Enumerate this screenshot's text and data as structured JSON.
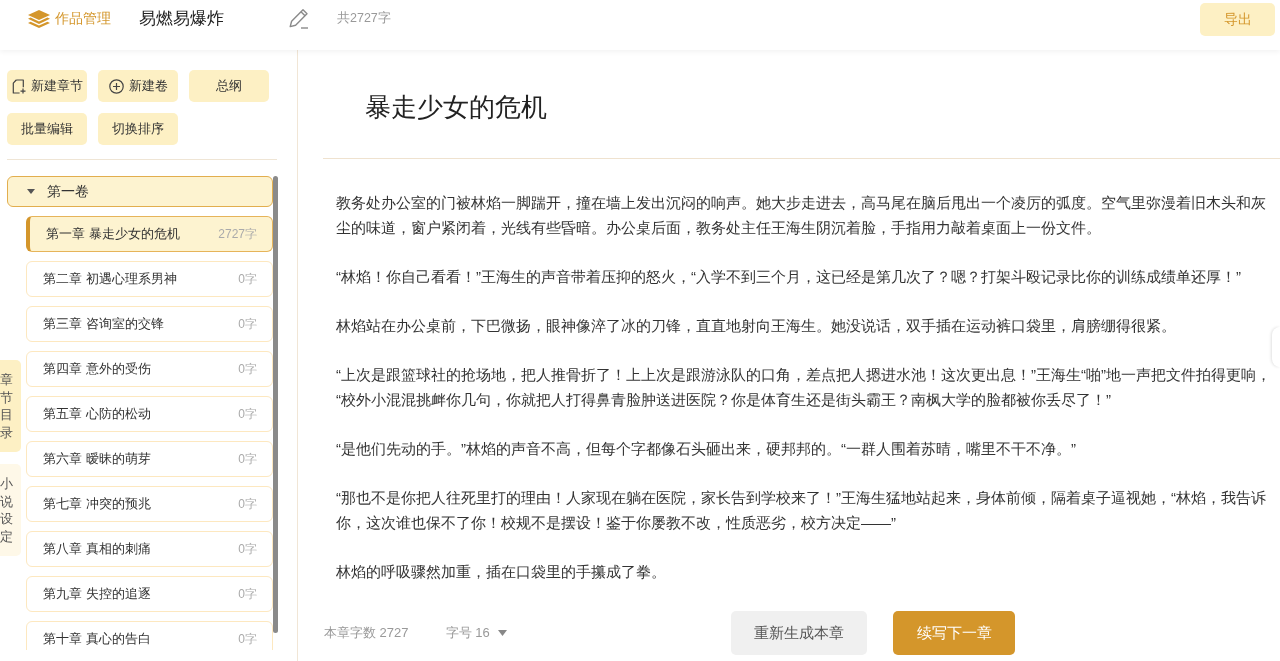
{
  "header": {
    "section_link": "作品管理",
    "book_title": "易燃易爆炸",
    "total_words": "共2727字",
    "export_button": "导出"
  },
  "toolbar": [
    {
      "label": "新建章节",
      "kind": "page"
    },
    {
      "label": "新建卷",
      "kind": "circle"
    },
    {
      "label": "总纲",
      "kind": "plain"
    },
    {
      "label": "批量编辑",
      "kind": "plain"
    },
    {
      "label": "切换排序",
      "kind": "plain"
    }
  ],
  "side_tabs": [
    {
      "label": "章节目录",
      "selected": true
    },
    {
      "label": "小说设定",
      "selected": false
    }
  ],
  "volumes": [
    {
      "title": "第一卷",
      "expanded": true,
      "children": [
        {
          "title": "第一章 暴走少女的危机",
          "words": "2727字",
          "selected": true
        },
        {
          "title": "第二章 初遇心理系男神",
          "words": "0字",
          "selected": false
        },
        {
          "title": "第三章 咨询室的交锋",
          "words": "0字",
          "selected": false
        },
        {
          "title": "第四章 意外的受伤",
          "words": "0字",
          "selected": false
        },
        {
          "title": "第五章 心防的松动",
          "words": "0字",
          "selected": false
        },
        {
          "title": "第六章 暧昧的萌芽",
          "words": "0字",
          "selected": false
        },
        {
          "title": "第七章 冲突的预兆",
          "words": "0字",
          "selected": false
        },
        {
          "title": "第八章 真相的刺痛",
          "words": "0字",
          "selected": false
        },
        {
          "title": "第九章 失控的追逐",
          "words": "0字",
          "selected": false
        },
        {
          "title": "第十章 真心的告白",
          "words": "0字",
          "selected": false
        }
      ]
    }
  ],
  "editor": {
    "title": "暴走少女的危机",
    "paragraphs": [
      "教务处办公室的门被林焰一脚踹开，撞在墙上发出沉闷的响声。她大步走进去，高马尾在脑后甩出一个凌厉的弧度。空气里弥漫着旧木头和灰尘的味道，窗户紧闭着，光线有些昏暗。办公桌后面，教务处主任王海生阴沉着脸，手指用力敲着桌面上一份文件。",
      "“林焰！你自己看看！”王海生的声音带着压抑的怒火，“入学不到三个月，这已经是第几次了？嗯？打架斗殴记录比你的训练成绩单还厚！”",
      "林焰站在办公桌前，下巴微扬，眼神像淬了冰的刀锋，直直地射向王海生。她没说话，双手插在运动裤口袋里，肩膀绷得很紧。",
      "“上次是跟篮球社的抢场地，把人推骨折了！上上次是跟游泳队的口角，差点把人摁进水池！这次更出息！”王海生“啪”地一声把文件拍得更响，“校外小混混挑衅你几句，你就把人打得鼻青脸肿送进医院？你是体育生还是街头霸王？南枫大学的脸都被你丢尽了！”",
      "“是他们先动的手。”林焰的声音不高，但每个字都像石头砸出来，硬邦邦的。“一群人围着苏晴，嘴里不干不净。”",
      "“那也不是你把人往死里打的理由！人家现在躺在医院，家长告到学校来了！”王海生猛地站起来，身体前倾，隔着桌子逼视她，“林焰，我告诉你，这次谁也保不了你！校规不是摆设！鉴于你屡教不改，性质恶劣，校方决定——”",
      "林焰的呼吸骤然加重，插在口袋里的手攥成了拳。"
    ]
  },
  "footer": {
    "chapter_words": "本章字数 2727",
    "font_size": "字号 16",
    "regenerate_button": "重新生成本章",
    "continue_button": "续写下一章"
  }
}
